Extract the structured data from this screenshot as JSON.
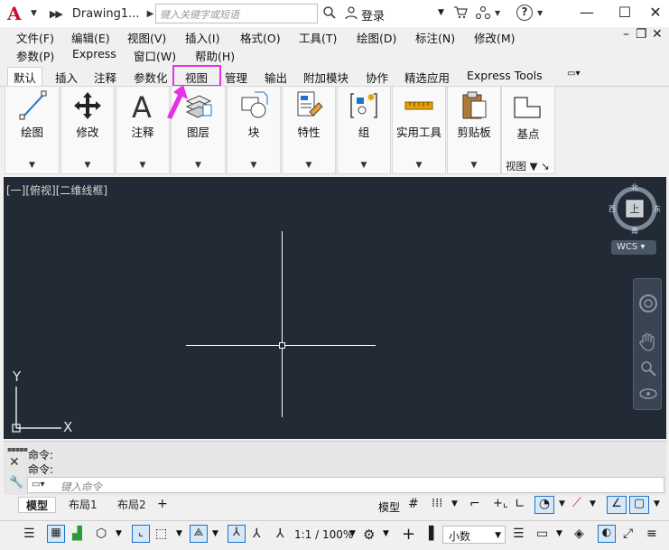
{
  "titlebar": {
    "logo": "A",
    "title": "Drawing1...",
    "search_placeholder": "键入关键字或短语",
    "login": "登录",
    "help": "?"
  },
  "menus": {
    "row1": [
      "文件(F)",
      "编辑(E)",
      "视图(V)",
      "插入(I)",
      "格式(O)",
      "工具(T)",
      "绘图(D)",
      "标注(N)",
      "修改(M)"
    ],
    "row2": [
      "参数(P)",
      "Express",
      "窗口(W)",
      "帮助(H)"
    ]
  },
  "tabs": [
    "默认",
    "插入",
    "注释",
    "参数化",
    "视图",
    "管理",
    "输出",
    "附加模块",
    "协作",
    "精选应用",
    "Express Tools"
  ],
  "active_tab": "默认",
  "highlighted_tab": "视图",
  "panels": [
    "绘图",
    "修改",
    "注释",
    "图层",
    "块",
    "特性",
    "组",
    "实用工具",
    "剪贴板"
  ],
  "base_panel": {
    "label": "基点",
    "footer": "视图"
  },
  "viewport": {
    "label": "[一][俯视][二维线框]"
  },
  "viewcube": {
    "top": "上",
    "north": "北",
    "south": "南",
    "east": "东",
    "west": "西",
    "wcs": "WCS"
  },
  "ucs": {
    "y": "Y",
    "x": "X"
  },
  "command": {
    "history": [
      "命令:",
      "命令:"
    ],
    "placeholder": "键入命令"
  },
  "layout_tabs": [
    "模型",
    "布局1",
    "布局2"
  ],
  "status": {
    "model": "模型",
    "scale": "1:1 / 100%",
    "units": "小数"
  },
  "colors": {
    "canvas": "#212a35",
    "highlight": "#e830e8",
    "logo": "#c8102e"
  }
}
